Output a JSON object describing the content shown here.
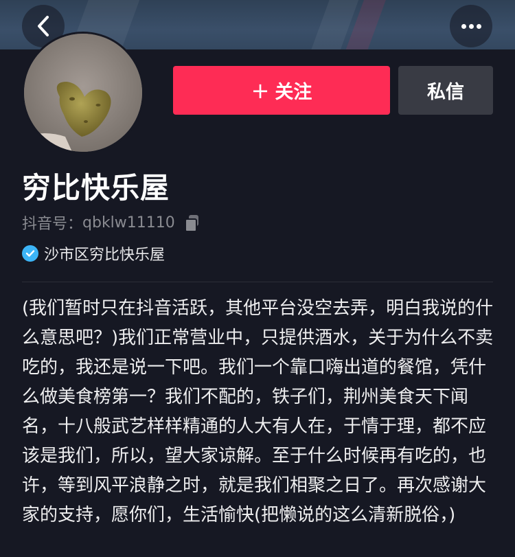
{
  "header": {
    "back_icon": "chevron-left-icon",
    "more_icon": "more-dots-icon"
  },
  "actions": {
    "follow_plus": "+",
    "follow_label": "关注",
    "message_label": "私信"
  },
  "profile": {
    "name": "穷比快乐屋",
    "account_prefix": "抖音号：",
    "account_id": "qbklw11110",
    "verification_text": "沙市区穷比快乐屋",
    "bio": "(我们暂时只在抖音活跃，其他平台没空去弄，明白我说的什么意思吧？)我们正常营业中，只提供酒水，关于为什么不卖吃的，我还是说一下吧。我们一个靠口嗨出道的餐馆，凭什么做美食榜第一？我们不配的，铁子们，荆州美食天下闻名，十八般武艺样样精通的人大有人在，于情于理，都不应该是我们，所以，望大家谅解。至于什么时候再有吃的，也许，等到风平浪静之时，就是我们相聚之日了。再次感谢大家的支持，愿你们，生活愉快(把懒说的这么清新脱俗，)"
  },
  "colors": {
    "background": "#161823",
    "follow_button": "#fe2c55",
    "message_button": "#393b44",
    "verify_badge": "#3cb4f6",
    "secondary_text": "#8a8b91"
  }
}
